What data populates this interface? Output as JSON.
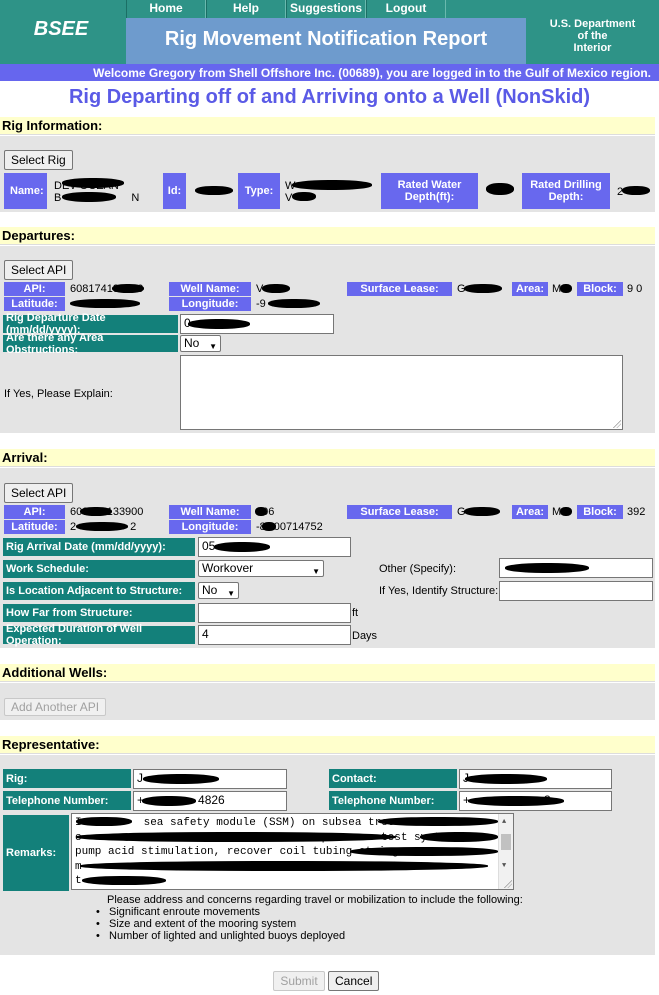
{
  "header": {
    "logo": "BSEE",
    "nav": [
      "Home",
      "Help",
      "Suggestions",
      "Logout"
    ],
    "title": "Rig Movement Notification Report",
    "dept": [
      "U.S. Department",
      "of the",
      "Interior"
    ],
    "welcome": "Welcome Gregory from Shell Offshore Inc. (00689), you are logged in to the Gulf of Mexico region."
  },
  "page_heading": "Rig Departing off of and Arriving onto a Well (NonSkid)",
  "rig": {
    "section": "Rig Information:",
    "select_btn": "Select Rig",
    "name_label": "Name:",
    "name_value_1": "DEV OCEAN",
    "name_value_2": "B",
    "name_value_3": "N",
    "id_label": "Id:",
    "type_label": "Type:",
    "type_value_1": "W",
    "type_value_2": "V",
    "water_depth_label": "Rated Water Depth(ft):",
    "drilling_depth_label": "Rated Drilling Depth:",
    "drilling_depth_value": "2"
  },
  "departures": {
    "section": "Departures:",
    "select_btn": "Select API",
    "api_label": "API:",
    "api_value": "608174139000",
    "well_name_label": "Well Name:",
    "well_name_value": "V",
    "surface_lease_label": "Surface Lease:",
    "surface_lease_value": "G",
    "area_label": "Area:",
    "area_value": "M",
    "block_label": "Block:",
    "block_value": "9",
    "block_value_2": "0",
    "latitude_label": "Latitude:",
    "longitude_label": "Longitude:",
    "longitude_value": "-9",
    "departure_date_label": "Rig Departure Date (mm/dd/yyyy):",
    "departure_date_value": "0",
    "obstructions_label": "Are there any Area Obstructions:",
    "obstructions_value": "No",
    "explain_label": "If Yes, Please Explain:"
  },
  "arrival": {
    "section": "Arrival:",
    "select_btn": "Select API",
    "api_label": "API:",
    "api_value": "608174133900",
    "well_name_label": "Well Name:",
    "well_name_value": "006",
    "surface_lease_label": "Surface Lease:",
    "surface_lease_value": "G",
    "area_label": "Area:",
    "area_value": "M",
    "block_label": "Block:",
    "block_value": "392",
    "latitude_label": "Latitude:",
    "latitude_value": "2",
    "latitude_value_2": "2",
    "longitude_label": "Longitude:",
    "longitude_value": "-8",
    "longitude_value_2": "00714752",
    "arrival_date_label": "Rig Arrival Date (mm/dd/yyyy):",
    "arrival_date_value": "05",
    "work_schedule_label": "Work Schedule:",
    "work_schedule_value": "Workover",
    "other_label": "Other (Specify):",
    "adjacent_label": "Is Location Adjacent to Structure:",
    "adjacent_value": "No",
    "identify_label": "If Yes, Identify Structure:",
    "how_far_label": "How Far from Structure:",
    "how_far_unit": "ft",
    "duration_label": "Expected Duration of Well Operation:",
    "duration_value": "4",
    "duration_unit": "Days"
  },
  "additional": {
    "section": "Additional Wells:",
    "add_btn": "Add Another API"
  },
  "rep": {
    "section": "Representative:",
    "rig_label": "Rig:",
    "rig_value": "J",
    "contact_label": "Contact:",
    "contact_value": "J",
    "phone_label": "Telephone Number:",
    "rig_phone_value": "+",
    "rig_phone_value_2": "4826",
    "contact_phone_value": "+",
    "contact_phone_value_2": "3",
    "remarks_label": "Remarks:",
    "remarks_lines": [
      "I",
      "c",
      "pump acid stimulation, recover coil tubing strings",
      "m",
      "t"
    ],
    "remarks_fragment_1": "sea safety module (SSM) on subsea tree",
    "remarks_fragment_2": "pressure test syst",
    "guidance_intro": "Please address and concerns regarding travel or mobilization to include the following:",
    "guidance_items": [
      "Significant enroute movements",
      "Size and extent of the mooring system",
      "Number of lighted and unlighted buoys deployed"
    ]
  },
  "footer": {
    "submit": "Submit",
    "cancel": "Cancel"
  }
}
